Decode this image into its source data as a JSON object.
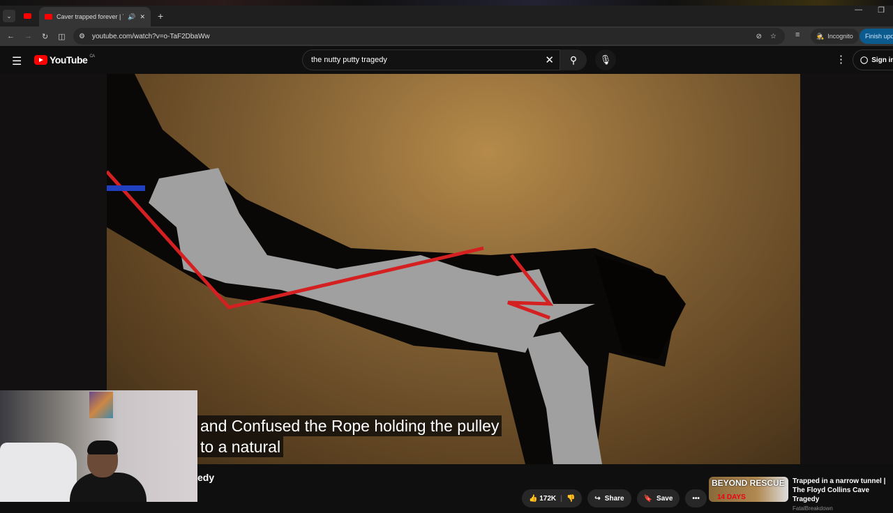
{
  "browser": {
    "tab_title": "Caver trapped forever | The",
    "url": "youtube.com/watch?v=o-TaF2DbaWw",
    "incognito_label": "Incognito",
    "finish_update_label": "Finish update"
  },
  "youtube": {
    "logo_text": "YouTube",
    "country": "CA",
    "search_value": "the nutty putty tragedy",
    "sign_in_label": "Sign in"
  },
  "video": {
    "caption_line1": "and Confused the Rope holding the pulley",
    "caption_line2": "to a natural",
    "title_visible": "edy",
    "like_count": "172K",
    "share_label": "Share",
    "save_label": "Save"
  },
  "recommendation": {
    "thumb_text1": "BEYOND RESCUE",
    "thumb_text2": "14 DAYS",
    "title": "Trapped in a narrow tunnel | The Floyd Collins Cave Tragedy",
    "channel": "FatalBreakdown"
  },
  "colors": {
    "accent": "#ff0000",
    "rope": "#d42020",
    "figure": "#a0a0a0"
  }
}
